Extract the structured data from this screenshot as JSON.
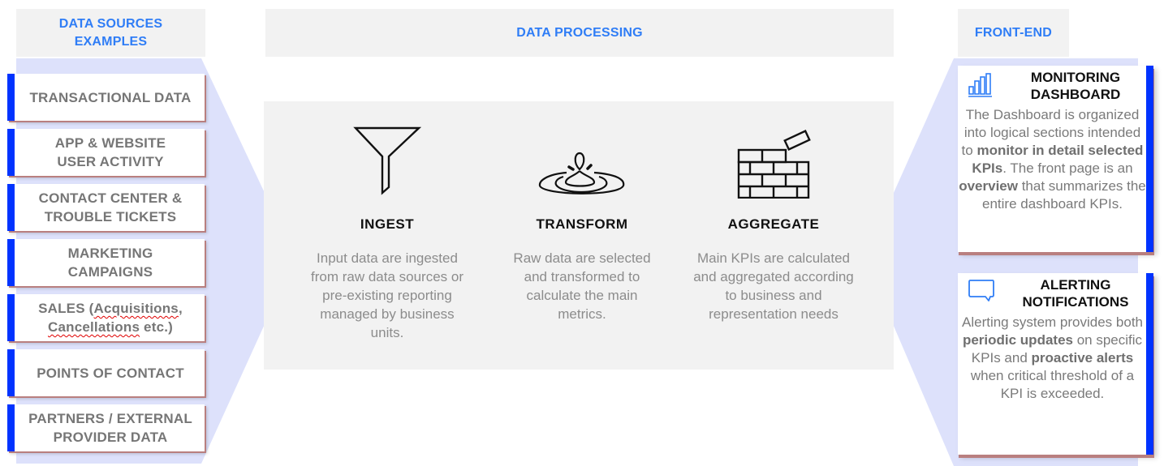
{
  "colors": {
    "header_text": "#2f7df6",
    "accent_bar": "#0033ff",
    "funnel_fill": "#dde1fb",
    "panel_bg": "#f2f2f2",
    "muted_text": "#767676",
    "icon_blue": "#2f7df6"
  },
  "headers": {
    "sources": "DATA SOURCES EXAMPLES",
    "processing": "DATA PROCESSING",
    "frontend": "FRONT-END"
  },
  "sources": [
    {
      "label": "TRANSACTIONAL DATA"
    },
    {
      "label": "APP & WEBSITE USER ACTIVITY"
    },
    {
      "label": "CONTACT CENTER & TROUBLE TICKETS"
    },
    {
      "label": "MARKETING CAMPAIGNS"
    },
    {
      "label_parts": [
        "SALES (",
        "Acquisitions",
        ",",
        "Cancellations",
        " etc.)"
      ]
    },
    {
      "label": "POINTS OF CONTACT"
    },
    {
      "label": "PARTNERS / EXTERNAL PROVIDER DATA"
    }
  ],
  "steps": [
    {
      "icon": "funnel-icon",
      "title": "INGEST",
      "description": "Input data are ingested from raw data sources or pre-existing reporting managed by business units."
    },
    {
      "icon": "water-drop-ripple-icon",
      "title": "TRANSFORM",
      "description": "Raw data are selected and transformed to calculate the main metrics."
    },
    {
      "icon": "brick-wall-icon",
      "title": "AGGREGATE",
      "description": "Main KPIs are calculated and aggregated according to business and representation needs"
    }
  ],
  "frontend": {
    "monitoring": {
      "icon": "bar-chart-icon",
      "title": "MONITORING DASHBOARD",
      "desc_1": "The Dashboard is organized into logical sections intended to ",
      "desc_bold_1": "monitor in detail selected KPIs",
      "desc_2": ". The front page is an ",
      "desc_bold_2": "overview",
      "desc_3": " that summarizes the entire dashboard KPIs."
    },
    "alerting": {
      "icon": "chat-bubble-icon",
      "title": "ALERTING NOTIFICATIONS",
      "desc_1": "Alerting system provides both ",
      "desc_bold_1": "periodic updates",
      "desc_2": " on specific KPIs and ",
      "desc_bold_2": "proactive alerts",
      "desc_3": " when critical threshold of a KPI is exceeded."
    }
  }
}
